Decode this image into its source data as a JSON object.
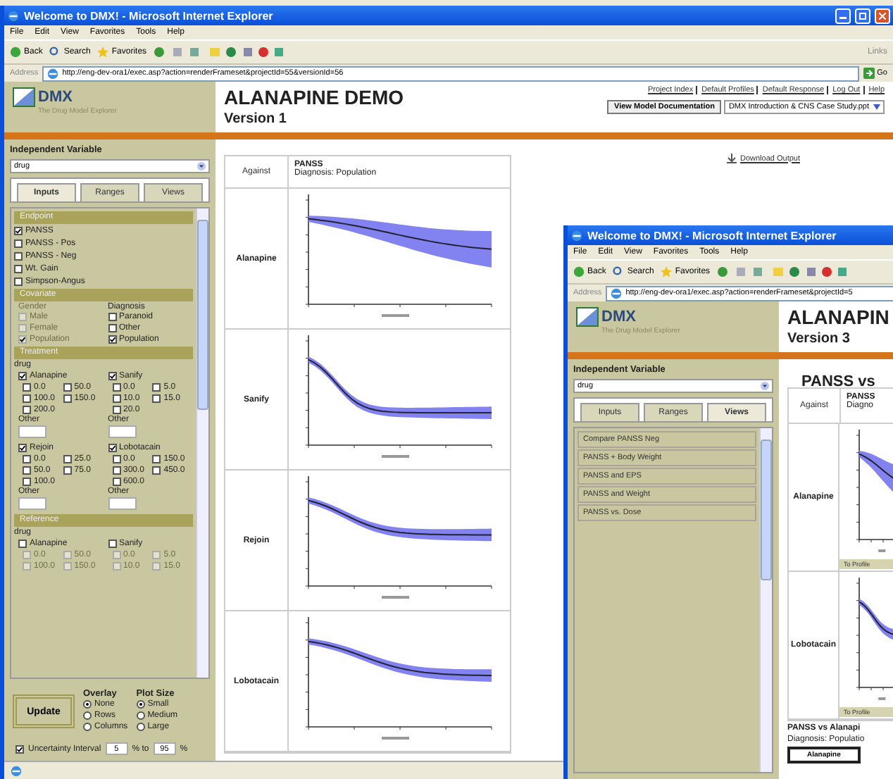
{
  "main_window": {
    "title": "Welcome to DMX! - Microsoft Internet Explorer",
    "menu": [
      "File",
      "Edit",
      "View",
      "Favorites",
      "Tools",
      "Help"
    ],
    "toolbar": [
      "Back",
      "Search",
      "Favorites"
    ],
    "links": "Links",
    "address_label": "Address",
    "url": "http://eng-dev-ora1/exec.asp?action=renderFrameset&projectId=55&versionId=56",
    "go": "Go",
    "logo": {
      "name": "DMX",
      "tagline": "The Drug Model Explorer"
    },
    "project_title": "ALANAPINE DEMO",
    "version": "Version 1",
    "nav_links": [
      "Project Index",
      "Default Profiles",
      "Default Response",
      "Log Out",
      "Help"
    ],
    "doc_button": "View Model Documentation",
    "doc_select": "DMX Introduction & CNS Case Study.ppt",
    "independent_variable": {
      "label": "Independent Variable",
      "value": "drug"
    },
    "tabs": [
      {
        "label": "Inputs",
        "selected": true
      },
      {
        "label": "Ranges",
        "selected": false
      },
      {
        "label": "Views",
        "selected": false
      }
    ],
    "sections": [
      {
        "title": "Endpoint",
        "kind": "checklist",
        "items": [
          {
            "label": "PANSS",
            "checked": true
          },
          {
            "label": "PANSS - Pos",
            "checked": false
          },
          {
            "label": "PANSS - Neg",
            "checked": false
          },
          {
            "label": "Wt. Gain",
            "checked": false
          },
          {
            "label": "Simpson-Angus",
            "checked": false
          }
        ]
      },
      {
        "title": "Covariate",
        "kind": "columns",
        "columns": [
          {
            "label": "Gender",
            "disabled": true,
            "items": [
              {
                "label": "Male",
                "checked": false
              },
              {
                "label": "Female",
                "checked": false
              },
              {
                "label": "Population",
                "checked": true
              }
            ]
          },
          {
            "label": "Diagnosis",
            "disabled": false,
            "items": [
              {
                "label": "Paranoid",
                "checked": false
              },
              {
                "label": "Other",
                "checked": false
              },
              {
                "label": "Population",
                "checked": true
              }
            ]
          }
        ]
      },
      {
        "title": "Treatment",
        "kind": "drugs",
        "variable": "drug",
        "drugs": [
          {
            "name": "Alanapine",
            "checked": true,
            "doses_disabled": false,
            "doses": [
              {
                "label": "0.0",
                "checked": false
              },
              {
                "label": "50.0",
                "checked": false
              },
              {
                "label": "100.0",
                "checked": false
              },
              {
                "label": "150.0",
                "checked": false
              },
              {
                "label": "200.0",
                "checked": false
              }
            ],
            "other": "Other"
          },
          {
            "name": "Sanify",
            "checked": true,
            "doses_disabled": false,
            "doses": [
              {
                "label": "0.0",
                "checked": false
              },
              {
                "label": "5.0",
                "checked": false
              },
              {
                "label": "10.0",
                "checked": false
              },
              {
                "label": "15.0",
                "checked": false
              },
              {
                "label": "20.0",
                "checked": false
              }
            ],
            "other": "Other"
          },
          {
            "name": "Rejoin",
            "checked": true,
            "doses_disabled": false,
            "doses": [
              {
                "label": "0.0",
                "checked": false
              },
              {
                "label": "25.0",
                "checked": false
              },
              {
                "label": "50.0",
                "checked": false
              },
              {
                "label": "75.0",
                "checked": false
              },
              {
                "label": "100.0",
                "checked": false
              }
            ],
            "other": "Other"
          },
          {
            "name": "Lobotacain",
            "checked": true,
            "doses_disabled": false,
            "doses": [
              {
                "label": "0.0",
                "checked": false
              },
              {
                "label": "150.0",
                "checked": false
              },
              {
                "label": "300.0",
                "checked": false
              },
              {
                "label": "450.0",
                "checked": false
              },
              {
                "label": "600.0",
                "checked": false
              }
            ],
            "other": "Other"
          }
        ]
      },
      {
        "title": "Reference",
        "kind": "drugs",
        "variable": "drug",
        "drugs": [
          {
            "name": "Alanapine",
            "checked": false,
            "doses_disabled": true,
            "doses": [
              {
                "label": "0.0",
                "checked": false
              },
              {
                "label": "50.0",
                "checked": false
              },
              {
                "label": "100.0",
                "checked": false
              },
              {
                "label": "150.0",
                "checked": false
              }
            ]
          },
          {
            "name": "Sanify",
            "checked": false,
            "doses_disabled": true,
            "doses": [
              {
                "label": "0.0",
                "checked": false
              },
              {
                "label": "5.0",
                "checked": false
              },
              {
                "label": "10.0",
                "checked": false
              },
              {
                "label": "15.0",
                "checked": false
              }
            ]
          }
        ]
      }
    ],
    "update_button": "Update",
    "overlay": {
      "label": "Overlay",
      "options": [
        {
          "label": "None",
          "selected": true
        },
        {
          "label": "Rows",
          "selected": false
        },
        {
          "label": "Columns",
          "selected": false
        }
      ]
    },
    "plot_size": {
      "label": "Plot Size",
      "options": [
        {
          "label": "Small",
          "selected": true
        },
        {
          "label": "Medium",
          "selected": false
        },
        {
          "label": "Large",
          "selected": false
        }
      ]
    },
    "uncertainty": {
      "label": "Uncertainty Interval",
      "checked": true,
      "low": "5",
      "between": "% to",
      "high": "95",
      "unit": "%"
    },
    "download": "Download Output",
    "table": {
      "against": "Against",
      "endpoint": "PANSS",
      "subtitle": "Diagnosis: Population",
      "rows": [
        "Alanapine",
        "Sanify",
        "Rejoin",
        "Lobotacain"
      ]
    }
  },
  "front_window": {
    "title": "Welcome to DMX! - Microsoft Internet Explorer",
    "menu": [
      "File",
      "Edit",
      "View",
      "Favorites",
      "Tools",
      "Help"
    ],
    "toolbar": [
      "Back",
      "Search",
      "Favorites"
    ],
    "address_label": "Address",
    "url": "http://eng-dev-ora1/exec.asp?action=renderFrameset&projectId=5",
    "logo": {
      "name": "DMX",
      "tagline": "The Drug Model Explorer"
    },
    "project_title": "ALANAPIN",
    "version": "Version 3",
    "independent_variable": {
      "label": "Independent Variable",
      "value": "drug"
    },
    "tabs": [
      {
        "label": "Inputs",
        "selected": false
      },
      {
        "label": "Ranges",
        "selected": false
      },
      {
        "label": "Views",
        "selected": true
      }
    ],
    "views": [
      "Compare PANSS Neg",
      "PANSS + Body Weight",
      "PANSS and EPS",
      "PANSS and Weight",
      "PANSS vs. Dose"
    ],
    "heading": "PANSS vs",
    "table": {
      "against": "Against",
      "endpoint": "PANSS",
      "subtitle": "Diagno",
      "rows": [
        {
          "name": "Alanapine",
          "link": "To Profile"
        },
        {
          "name": "Lobotacain",
          "link": "To Profile"
        }
      ]
    },
    "caption": "PANSS vs Alanapi",
    "caption_sub": "Diagnosis: Populatio",
    "legend": "Alanapine"
  }
}
